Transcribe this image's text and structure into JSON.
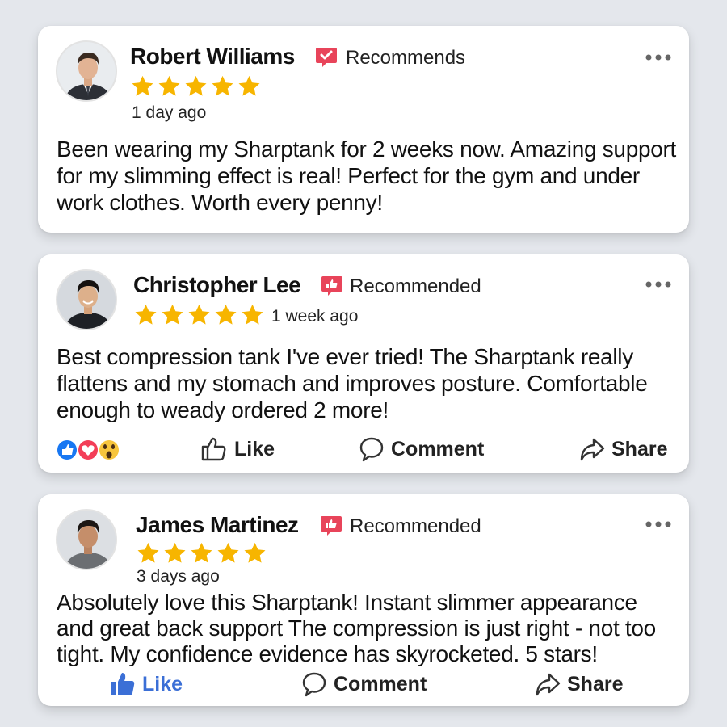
{
  "reviews": [
    {
      "name": "Robert Williams",
      "recommend_label": "Recommends",
      "rating": 5,
      "time": "1 day ago",
      "text": "Been wearing my Sharptank for 2 weeks now. Amazing support for my slimming effect is real! Perfect for the gym and under work clothes. Worth every penny!",
      "has_actions": false
    },
    {
      "name": "Christopher Lee",
      "recommend_label": "Recommended",
      "rating": 5,
      "time": "1 week ago",
      "text": "Best compression tank I've ever tried! The Sharptank really flattens and my stomach and improves posture. Comfortable enough to weady ordered 2 more!",
      "has_actions": true,
      "reactions": [
        "like-reaction-icon",
        "love-reaction-icon",
        "wow-reaction-icon"
      ],
      "actions": {
        "like": "Like",
        "comment": "Comment",
        "share": "Share"
      }
    },
    {
      "name": "James Martinez",
      "recommend_label": "Recommended",
      "rating": 5,
      "time": "3 days ago",
      "text": "Absolutely love this Sharptank! Instant slimmer appearance and great back support The compression is just right - not too tight. My confidence evidence has skyrocketed. 5 stars!",
      "has_actions": true,
      "like_active": true,
      "actions": {
        "like": "Like",
        "comment": "Comment",
        "share": "Share"
      }
    }
  ],
  "colors": {
    "background": "#e4e7ec",
    "card": "#ffffff",
    "star": "#f7b500",
    "badge": "#e8445a",
    "like_active": "#3b6fd6",
    "icons": "#333333"
  },
  "icons": {
    "badge": "thumbs-up-badge-icon",
    "more": "more-options-icon",
    "like": "thumbs-up-icon",
    "comment": "speech-bubble-icon",
    "share": "share-arrow-icon"
  }
}
